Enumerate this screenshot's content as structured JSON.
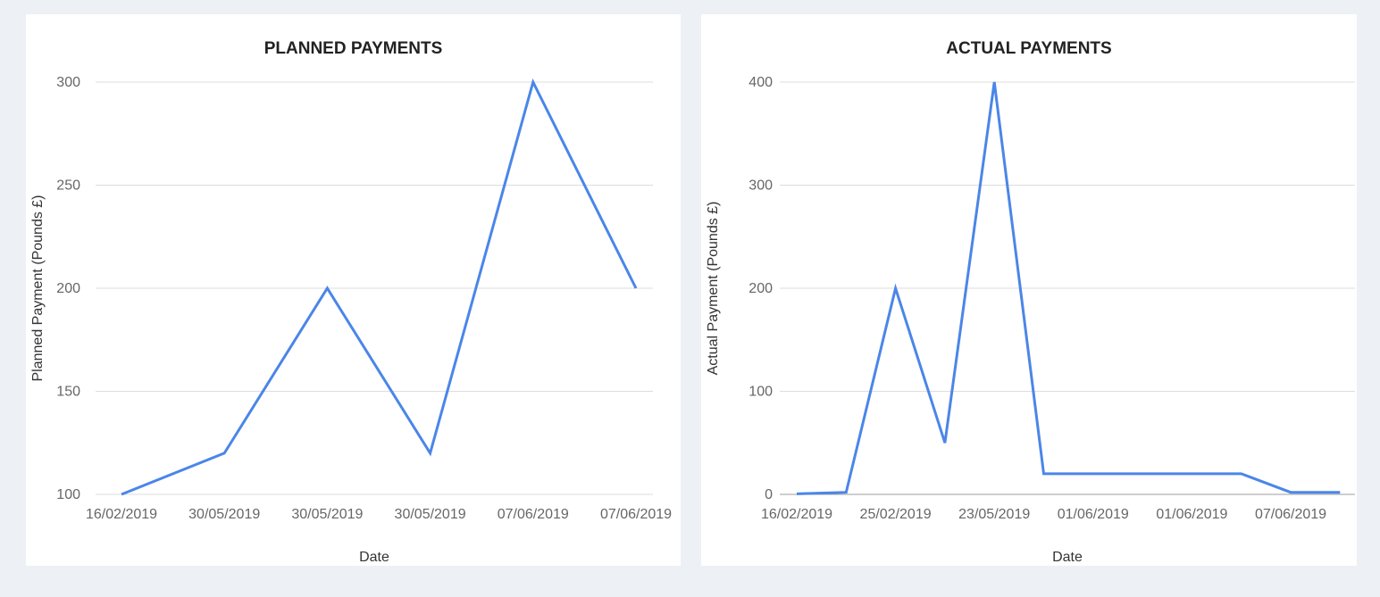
{
  "colors": {
    "background": "#edf0f4",
    "panel": "#ffffff",
    "line": "#4a86e8",
    "grid": "#dddddd",
    "baseline": "#9e9e9e",
    "tick_text": "#666666",
    "label_text": "#333333"
  },
  "chart_data": [
    {
      "type": "line",
      "title": "PLANNED PAYMENTS",
      "xlabel": "Date",
      "ylabel": "Planned Payment (Pounds £)",
      "categories": [
        "16/02/2019",
        "30/05/2019",
        "30/05/2019",
        "30/05/2019",
        "07/06/2019",
        "07/06/2019"
      ],
      "series": [
        {
          "values": [
            100,
            120,
            200,
            120,
            300,
            200
          ]
        }
      ],
      "ylim": [
        100,
        300
      ],
      "yticks": [
        100,
        150,
        200,
        250,
        300
      ],
      "grid": true,
      "legend": "none"
    },
    {
      "type": "line",
      "title": "ACTUAL PAYMENTS",
      "xlabel": "Date",
      "ylabel": "Actual Payment (Pounds £)",
      "categories": [
        "16/02/2019",
        "",
        "25/02/2019",
        "",
        "23/05/2019",
        "",
        "01/06/2019",
        "",
        "01/06/2019",
        "",
        "07/06/2019",
        ""
      ],
      "series": [
        {
          "values": [
            0.5,
            2,
            200,
            50,
            400,
            20,
            20,
            20,
            20,
            20,
            2,
            2
          ]
        }
      ],
      "ylim": [
        0,
        400
      ],
      "yticks": [
        0,
        100,
        200,
        300,
        400
      ],
      "grid": true,
      "legend": "none"
    }
  ]
}
